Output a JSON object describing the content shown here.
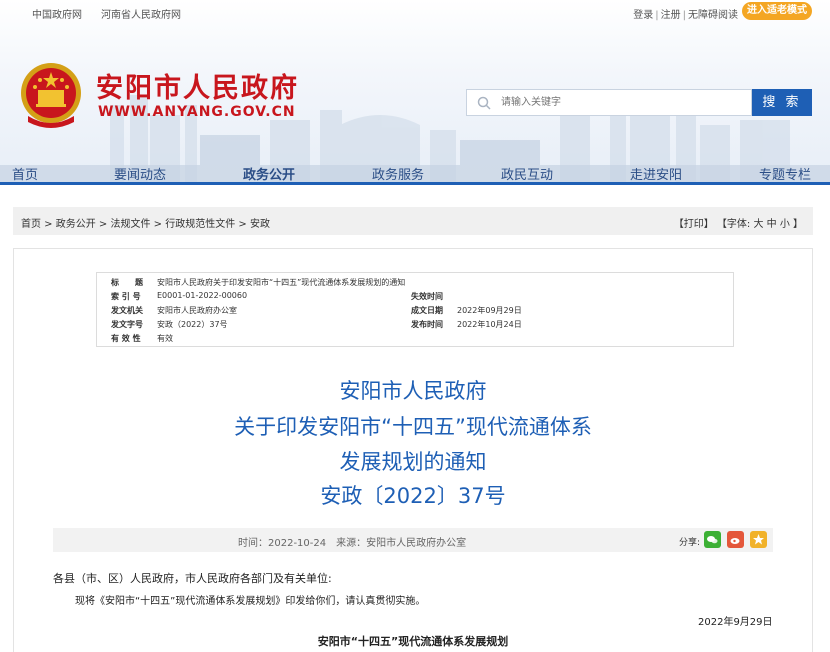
{
  "topbar": {
    "links": [
      "中国政府网",
      "河南省人民政府网"
    ],
    "login": "登录",
    "register": "注册",
    "accessibility": "无障碍阅读",
    "elder_mode": "进入适老模式"
  },
  "header": {
    "site_title": "安阳市人民政府",
    "site_url": "WWW.ANYANG.GOV.CN"
  },
  "search": {
    "placeholder": "请输入关键字",
    "button_label": "搜 索"
  },
  "nav": {
    "items": [
      "首页",
      "要闻动态",
      "政务公开",
      "政务服务",
      "政民互动",
      "走进安阳",
      "专题专栏"
    ],
    "active": "政务公开"
  },
  "breadcrumb": {
    "path": "首页 > 政务公开 > 法规文件 > 行政规范性文件 > 安政",
    "tools": "【打印】 【字体: 大 中 小 】"
  },
  "meta": {
    "title_key": "标　　题",
    "title_value": "安阳市人民政府关于印发安阳市“十四五”现代流通体系发展规划的通知",
    "index_key": "索 引 号",
    "index_value": "E0001-01-2022-00060",
    "expire_key": "失效时间",
    "expire_value": "",
    "issuer_key": "发文机关",
    "issuer_value": "安阳市人民政府办公室",
    "made_key": "成文日期",
    "made_value": "2022年09月29日",
    "doc_no_key": "发文字号",
    "doc_no_value": "安政（2022）37号",
    "publish_key": "发布时间",
    "publish_value": "2022年10月24日",
    "validity_key": "有 效 性",
    "validity_value": "有效"
  },
  "document": {
    "title_lines": [
      "安阳市人民政府",
      "关于印发安阳市“十四五”现代流通体系",
      "发展规划的通知",
      "安政〔2022〕37号"
    ],
    "info": "时间：2022-10-24　来源：安阳市人民政府办公室",
    "share_label": "分享:",
    "salutation": "各县（市、区）人民政府，市人民政府各部门及有关单位:",
    "paragraph": "现将《安阳市“十四五”现代流通体系发展规划》印发给你们，请认真贯彻实施。",
    "date": "2022年9月29日",
    "subtitle": "安阳市“十四五”现代流通体系发展规划"
  }
}
